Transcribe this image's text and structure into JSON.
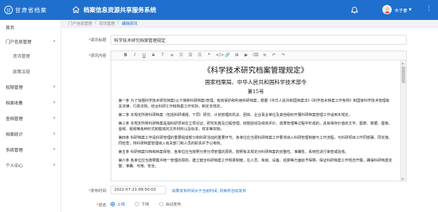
{
  "header": {
    "logo_seal": "甘",
    "logo_text": "甘肃省档案",
    "system_title": "档案信息资源共享服务系统",
    "user_name": "木子妻",
    "brand_color": "#1f6fce"
  },
  "sidebar": {
    "items": [
      {
        "label": "首页",
        "chevron": ""
      },
      {
        "label": "门户信息管理",
        "chevron": "∨"
      },
      {
        "label": "资讯管理",
        "chevron": ""
      },
      {
        "label": "政策法规",
        "chevron": ""
      },
      {
        "label": "权限管理",
        "chevron": "∨"
      },
      {
        "label": "档案收集",
        "chevron": "∨"
      },
      {
        "label": "查档管理",
        "chevron": "∨"
      },
      {
        "label": "档案统计",
        "chevron": "∨"
      },
      {
        "label": "系统管理",
        "chevron": "∨"
      },
      {
        "label": "个人中心",
        "chevron": "∨"
      }
    ]
  },
  "breadcrumb": {
    "items": [
      "门户信息管理",
      "/",
      "资讯管理",
      "/"
    ],
    "current": "编辑资讯"
  },
  "form": {
    "title_label": "资讯标题",
    "title_value": "科学技术研究档案管理规定",
    "content_label": "资讯内容",
    "publish_label": "发布时间",
    "publish_value": "2022-07-21 09:50:03",
    "publish_hint": "如果发布时间大于当前时间, 则到时自动发布",
    "status_label": "状态",
    "status_options": [
      "上线",
      "下线",
      "自动发布"
    ],
    "status_selected": "上线"
  },
  "toolbar": [
    "B",
    "I",
    "U",
    "S",
    "T",
    "≡",
    "☷",
    "☰",
    "☶",
    "❝",
    "</>",
    "🔗",
    "⊞",
    "▶",
    "⌫",
    "≋",
    "↶",
    "↷"
  ],
  "document": {
    "title": "《科学技术研究档案管理规定》",
    "org": "国家档案局、中华人民共和国科学技术部令",
    "number": "第15号",
    "paragraphs": [
      "第一条 为了加强科学技术研究档案(以下简称科研档案)管理，有效保护和利用科研档案，根据《中华人民共和国档案法》《科学技术档案工作条例》和国家科学技术管理有关法律、行政法规，结合科研工作和档案工作实际，制定本规定。",
      "第二条 本规定所称科研档案（包括科研课题、下同）研究、计划管理的机关、团体、企业事业单位及其他组织开展科研档案管理工作适用本规定。",
      "第三条 本规定所称科研档案是指科研项目在立项论证、研究实施及过程管理、结题验收及绩效评价、成果管理等过程中形成的，具有保存价值的文字、图表、数据、图像、音频、视频等各种形式和载体的文件材料以及标本、样本等实物。",
      "第四条 科研档案工作是科研管理的重要组成部分和科研活动的重要环节。各单位应当把科研档案工作要求纳入科研管理制度与工作流程，与科研项目工作同部署、同实施、同检查，将科研档案管理纳入有关部门和人员的职责并予以考核。",
      "第五条 科研档案归档和档案保管、各单位应当按照分类分项管理的原则，按照有关规定对科研档案的完整性、准确性、系统性进行审查或验收。",
      "第六条 各单位应当按照集中统一管理的原则，建立健全科研档案工作规章制度，在人员、库房、设备、经费等方面给予保障，保证科研档案工作规范开展，确保科研档案完整、准确、可用、安全。"
    ]
  }
}
